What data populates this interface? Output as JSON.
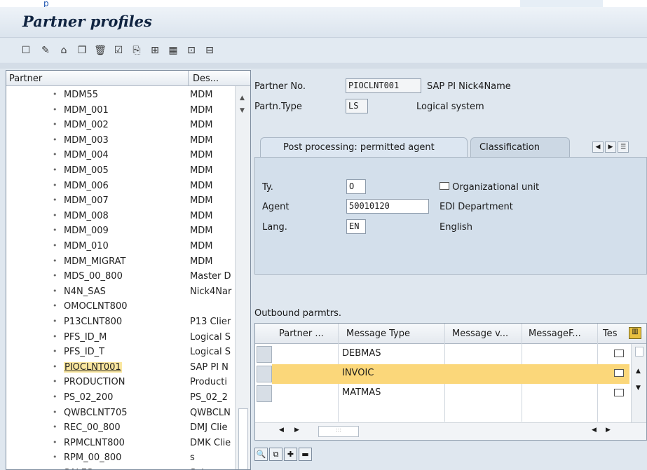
{
  "title": "Partner profiles",
  "toolbar": {
    "icons": [
      "new-icon",
      "change-icon",
      "display-icon",
      "copy-icon",
      "delete-icon",
      "check-icon",
      "paste-icon",
      "tree-icon",
      "table-icon",
      "expand-icon",
      "info-icon"
    ]
  },
  "tree": {
    "header_partner": "Partner",
    "header_desc": "Des...",
    "rows": [
      {
        "name": "MDM55",
        "desc": "MDM"
      },
      {
        "name": "MDM_001",
        "desc": "MDM"
      },
      {
        "name": "MDM_002",
        "desc": "MDM"
      },
      {
        "name": "MDM_003",
        "desc": "MDM"
      },
      {
        "name": "MDM_004",
        "desc": "MDM"
      },
      {
        "name": "MDM_005",
        "desc": "MDM"
      },
      {
        "name": "MDM_006",
        "desc": "MDM"
      },
      {
        "name": "MDM_007",
        "desc": "MDM"
      },
      {
        "name": "MDM_008",
        "desc": "MDM"
      },
      {
        "name": "MDM_009",
        "desc": "MDM"
      },
      {
        "name": "MDM_010",
        "desc": "MDM"
      },
      {
        "name": "MDM_MIGRAT",
        "desc": "MDM"
      },
      {
        "name": "MDS_00_800",
        "desc": "Master D"
      },
      {
        "name": "N4N_SAS",
        "desc": "Nick4Nar"
      },
      {
        "name": "OMOCLNT800",
        "desc": ""
      },
      {
        "name": "P13CLNT800",
        "desc": "P13 Clier"
      },
      {
        "name": "PFS_ID_M",
        "desc": "Logical S"
      },
      {
        "name": "PFS_ID_T",
        "desc": "Logical S"
      },
      {
        "name": "PIOCLNT001",
        "desc": "SAP PI N"
      },
      {
        "name": "PRODUCTION",
        "desc": "Producti"
      },
      {
        "name": "PS_02_200",
        "desc": "PS_02_2"
      },
      {
        "name": "QWBCLNT705",
        "desc": "QWBCLN"
      },
      {
        "name": "REC_00_800",
        "desc": "DMJ Clie"
      },
      {
        "name": "RPMCLNT800",
        "desc": "DMK Clie"
      },
      {
        "name": "RPM_00_800",
        "desc": "s"
      },
      {
        "name": "SALES",
        "desc": "Sales or"
      }
    ],
    "selected_index": 18
  },
  "partner": {
    "no_label": "Partner No.",
    "no_value": "PIOCLNT001",
    "no_text": "SAP PI Nick4Name",
    "type_label": "Partn.Type",
    "type_value": "LS",
    "type_text": "Logical system"
  },
  "tabs": {
    "active": "Post processing: permitted agent",
    "inactive": "Classification"
  },
  "agent": {
    "ty_label": "Ty.",
    "ty_value": "O",
    "ty_text": "Organizational unit",
    "agent_label": "Agent",
    "agent_value": "50010120",
    "agent_text": "EDI Department",
    "lang_label": "Lang.",
    "lang_value": "EN",
    "lang_text": "English"
  },
  "outbound": {
    "label": "Outbound parmtrs.",
    "columns": [
      "Partner ...",
      "Message Type",
      "Message v...",
      "MessageF...",
      "Tes"
    ],
    "rows": [
      {
        "message_type": "DEBMAS"
      },
      {
        "message_type": "INVOIC"
      },
      {
        "message_type": "MATMAS"
      }
    ],
    "selected_index": 1
  },
  "colors": {
    "selection": "#fbd77a",
    "panel": "#d3dfeb"
  }
}
